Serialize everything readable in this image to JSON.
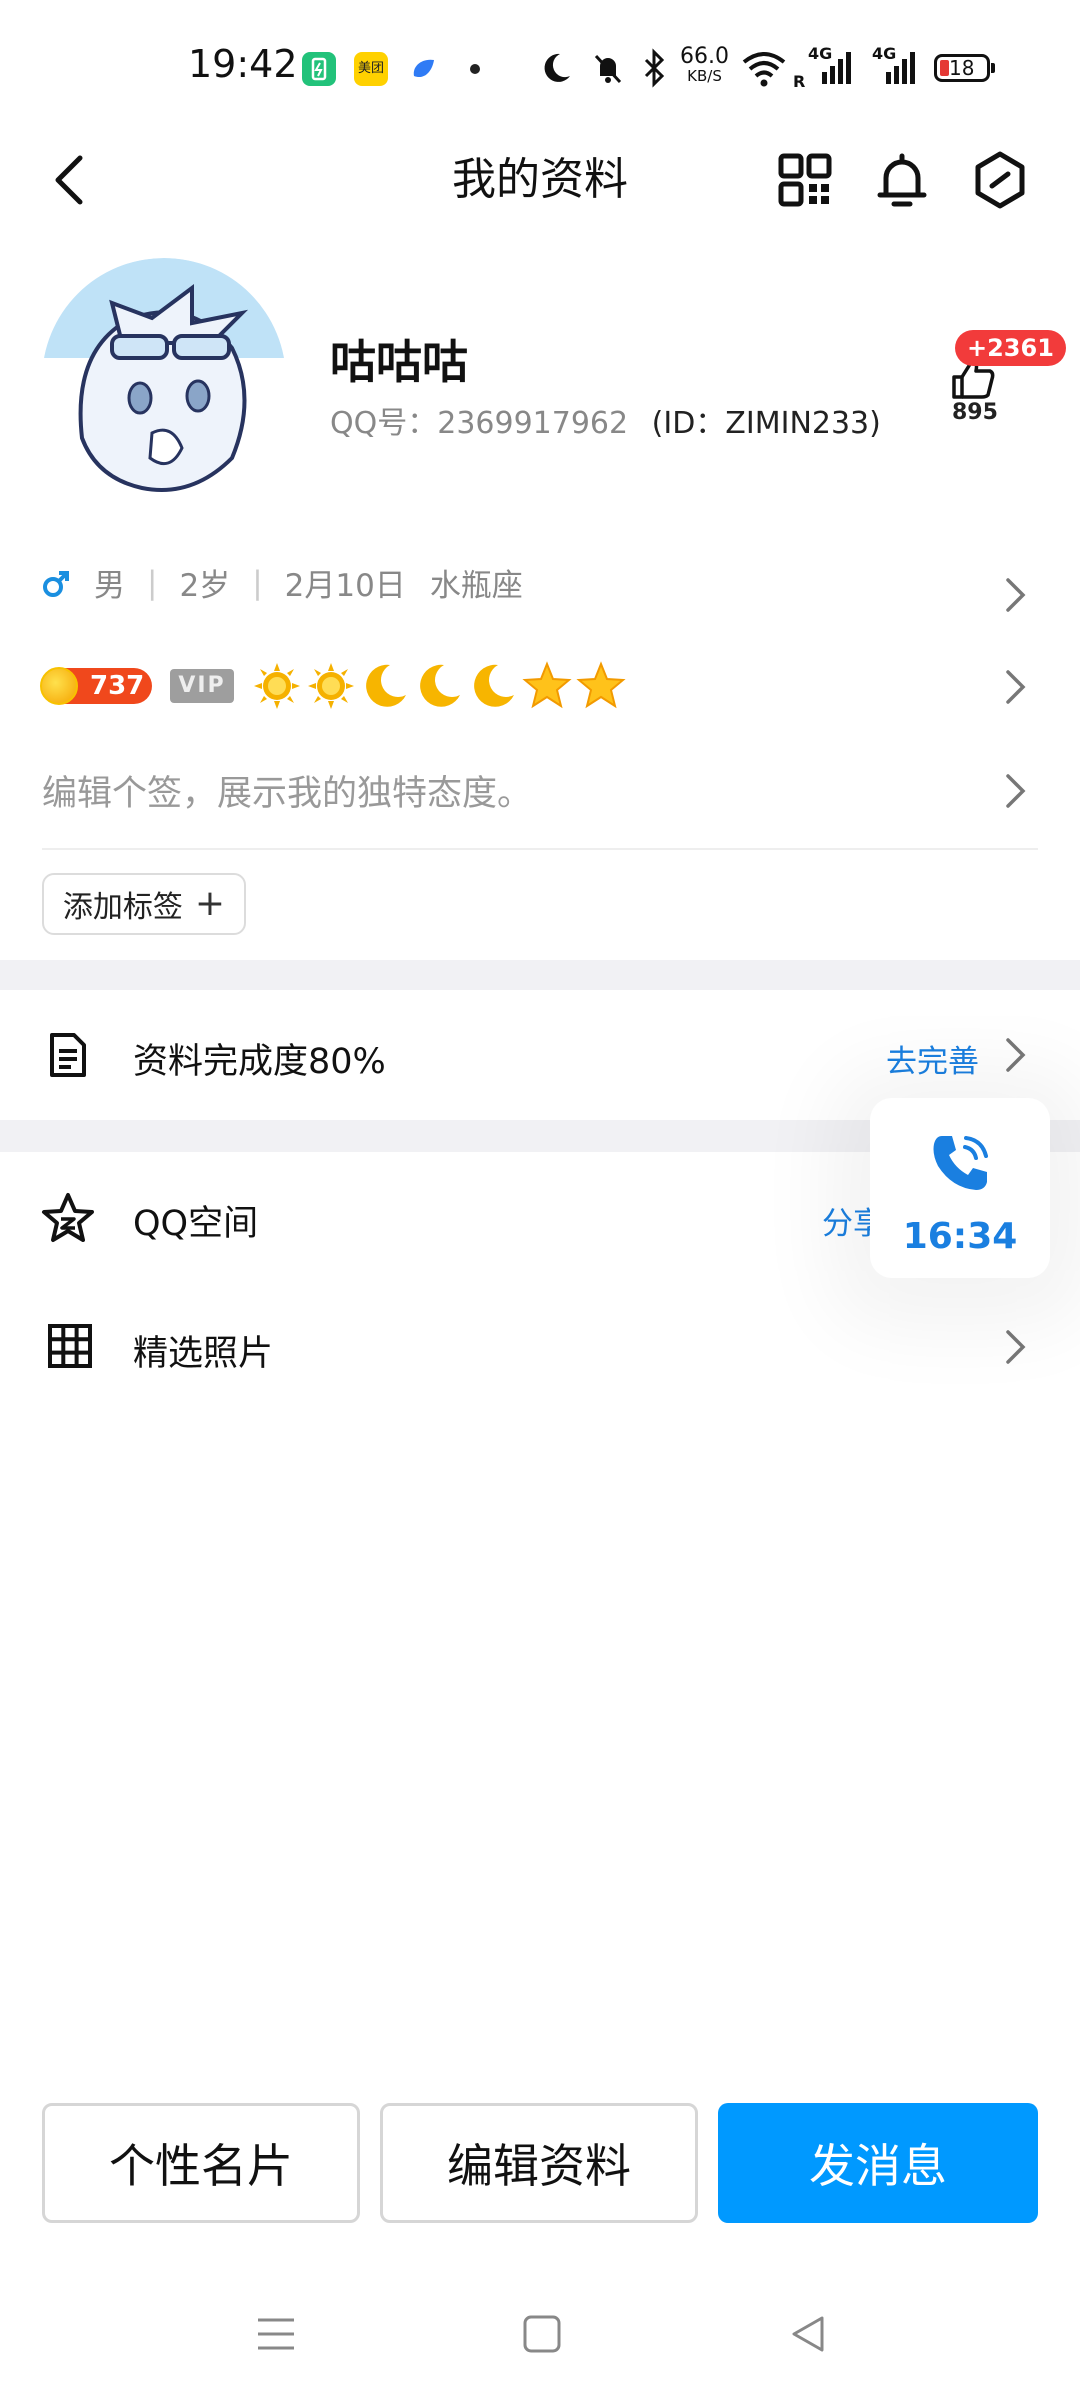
{
  "status_bar": {
    "time": "19:42",
    "apps": [
      "battery-app-icon",
      "meituan-app-icon",
      "blue-app-icon"
    ],
    "meituan_label": "美团",
    "net_speed": "66.0",
    "net_unit": "KB/S",
    "signal_1": "4G",
    "signal_2": "4G",
    "roaming": "R",
    "battery": "18"
  },
  "header": {
    "title": "我的资料",
    "icons": [
      "qr-code-icon",
      "bell-icon",
      "settings-hexagon-icon"
    ]
  },
  "profile": {
    "nickname": "咕咕咕",
    "qq_label": "QQ号：",
    "qq_number": "2369917962",
    "id_text": "(ID：ZIMIN233)",
    "likes_badge": "+2361",
    "likes_count": "895",
    "gender": "男",
    "age": "2岁",
    "birthday": "2月10日",
    "zodiac": "水瓶座",
    "coin_value": "737",
    "vip_label": "VIP",
    "level_icons": [
      "sun-icon",
      "sun-icon",
      "moon-icon",
      "moon-icon",
      "moon-icon",
      "star-icon",
      "star-icon"
    ],
    "signature_placeholder": "编辑个签，展示我的独特态度。",
    "add_tag_label": "添加标签"
  },
  "completion": {
    "label": "资料完成度80%",
    "action": "去完善"
  },
  "menu": {
    "qzone_label": "QQ空间",
    "qzone_action": "分享",
    "photos_label": "精选照片"
  },
  "call_float": {
    "time": "16:34"
  },
  "buttons": {
    "card": "个性名片",
    "edit": "编辑资料",
    "message": "发消息"
  },
  "colors": {
    "accent": "#0099ff",
    "link": "#1a7fe0",
    "badge": "#f23b3b"
  }
}
